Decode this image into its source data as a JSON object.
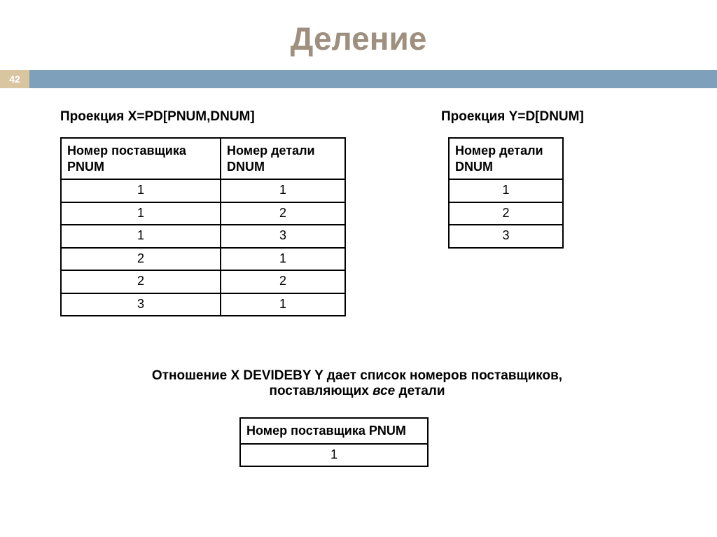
{
  "page_number": "42",
  "title": "Деление",
  "projection_x_caption": "Проекция X=PD[PNUM,DNUM]",
  "projection_y_caption": "Проекция Y=D[DNUM]",
  "table_x": {
    "header_col1": "Номер поставщика PNUM",
    "header_col2": "Номер детали DNUM",
    "rows": [
      {
        "c1": "1",
        "c2": "1"
      },
      {
        "c1": "1",
        "c2": "2"
      },
      {
        "c1": "1",
        "c2": "3"
      },
      {
        "c1": "2",
        "c2": "1"
      },
      {
        "c1": "2",
        "c2": "2"
      },
      {
        "c1": "3",
        "c2": "1"
      }
    ]
  },
  "table_y": {
    "header": "Номер детали DNUM",
    "rows": [
      {
        "v": "1"
      },
      {
        "v": "2"
      },
      {
        "v": "3"
      }
    ]
  },
  "explanation_line1": "Отношение X DEVIDEBY Y дает список номеров поставщиков,",
  "explanation_line2_prefix": "поставляющих ",
  "explanation_line2_italic": "все",
  "explanation_line2_suffix": " детали",
  "table_result": {
    "header": "Номер поставщика PNUM",
    "rows": [
      {
        "v": "1"
      }
    ]
  }
}
